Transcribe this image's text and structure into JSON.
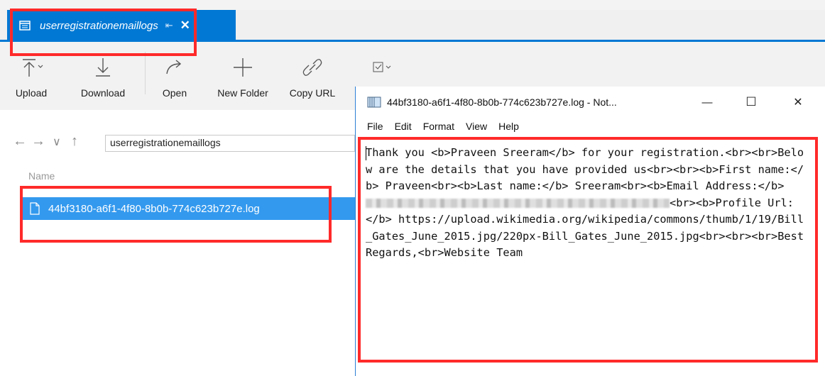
{
  "tab": {
    "title": "userregistrationemaillogs",
    "pin_glyph": "⇤",
    "close_glyph": "✕"
  },
  "toolbar": {
    "buttons": [
      {
        "label": "Upload",
        "icon": "upload-icon"
      },
      {
        "label": "Download",
        "icon": "download-icon"
      },
      {
        "label": "Open",
        "icon": "open-icon"
      },
      {
        "label": "New Folder",
        "icon": "plus-icon"
      },
      {
        "label": "Copy URL",
        "icon": "link-icon"
      },
      {
        "label": "",
        "icon": "select-all-icon"
      },
      {
        "label": "",
        "icon": "copy-icon"
      },
      {
        "label": "",
        "icon": "paste-icon"
      },
      {
        "label": "",
        "icon": "rename-icon"
      },
      {
        "label": "",
        "icon": "delete-icon"
      },
      {
        "label": "",
        "icon": "refresh-icon"
      }
    ]
  },
  "nav": {
    "back": "←",
    "forward": "→",
    "dropdown": "∨",
    "up": "↑",
    "path": "userregistrationemaillogs"
  },
  "list": {
    "column_name": "Name",
    "files": [
      {
        "name": "44bf3180-a6f1-4f80-8b0b-774c623b727e.log"
      }
    ]
  },
  "notepad": {
    "title": "44bf3180-a6f1-4f80-8b0b-774c623b727e.log - Not...",
    "controls": {
      "minimize": "—",
      "maximize": "☐",
      "close": "✕"
    },
    "menu": [
      "File",
      "Edit",
      "Format",
      "View",
      "Help"
    ],
    "content_before_redaction": "Thank you <b>Praveen Sreeram</b> for your registration.<br><br>Below are the details that you have provided us<br><br><b>First name:</b> Praveen<br><b>Last name:</b> Sreeram<br><b>Email Address:</b> ",
    "content_after_redaction": "<br><b>Profile Url:</b> https://upload.wikimedia.org/wikipedia/commons/thumb/1/19/Bill_Gates_June_2015.jpg/220px-Bill_Gates_June_2015.jpg<br><br><br>Best Regards,<br>Website Team"
  },
  "colors": {
    "accent": "#0078d4",
    "selection": "#3399ee",
    "highlight": "#ff2a2a"
  }
}
